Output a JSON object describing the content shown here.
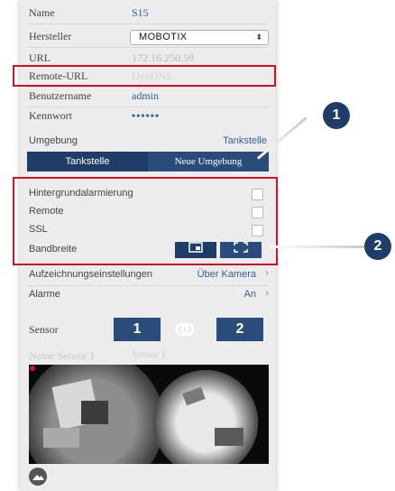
{
  "fields": {
    "name_label": "Name",
    "name_value": "S15",
    "manufacturer_label": "Hersteller",
    "manufacturer_value": "MOBOTIX",
    "url_label": "URL",
    "url_value": "172.16.250.59",
    "remote_url_label": "Remote-URL",
    "remote_url_placeholder": "DynDNS",
    "username_label": "Benutzername",
    "username_value": "admin",
    "password_label": "Kennwort",
    "password_value": "••••••"
  },
  "environment": {
    "label": "Umgebung",
    "value": "Tankstelle",
    "segments": [
      "Tankstelle",
      "Neue Umgebung"
    ]
  },
  "options": {
    "background_arming": "Hintergrundalarmierung",
    "remote": "Remote",
    "ssl": "SSL",
    "bandwidth": "Bandbreite"
  },
  "recording": {
    "label": "Aufzeichnungseinstellungen",
    "value": "Über Kamera"
  },
  "alarms": {
    "label": "Alarme",
    "value": "An"
  },
  "sensor": {
    "label": "Sensor",
    "btn1": "1",
    "btn2": "2",
    "link_icon": "link-rings-icon",
    "name_label": "Name Sensor 1",
    "name_placeholder": "Sensor 1"
  },
  "callouts": [
    "1",
    "2"
  ],
  "colors": {
    "accent": "#2a4c7a",
    "accent_dark": "#1f3d66",
    "value_blue": "#2f5f99",
    "highlight_red": "#d01428"
  }
}
